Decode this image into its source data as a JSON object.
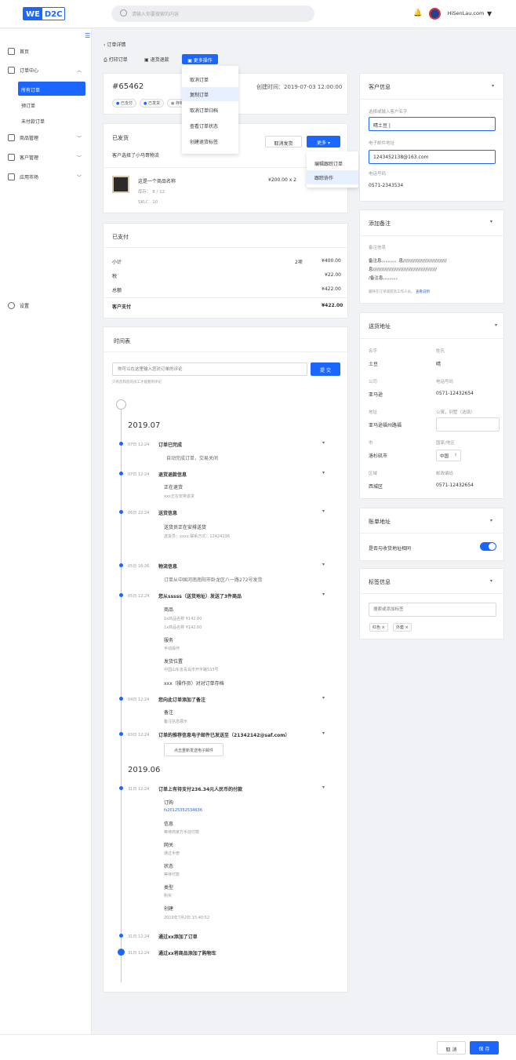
{
  "header": {
    "logo_we": "WE",
    "logo_d2c": "D2C",
    "search_placeholder": "请输入你要搜索的内容",
    "user": "HiSenLau.com"
  },
  "sidebar": {
    "home": "首页",
    "orders": "订单中心",
    "all_orders": "所有订单",
    "pre_orders": "预订单",
    "unpaid": "未付款订单",
    "products": "商品管理",
    "customers": "客户管理",
    "market": "应用市场",
    "settings": "设置"
  },
  "toolbar": {
    "back": "订单详情",
    "print": "打印订单",
    "refund": "退货退款",
    "more": "更多操作"
  },
  "more_menu": [
    "取消订单",
    "复制订单",
    "取消订单归档",
    "查看订单状态",
    "创建退货标签"
  ],
  "order": {
    "id": "#65462",
    "created": "创建时间：2019-07-03 12:00:00",
    "tags": [
      "已支付",
      "已发货",
      "存档"
    ]
  },
  "shipping": {
    "title": "已发货",
    "desc": "客户选择了小马哥物流",
    "cancel": "取消发货",
    "more": "更多",
    "menu": [
      "编辑跟踪订单",
      "跟踪协作"
    ],
    "item_name": "这是一个商品名称",
    "item_price": "¥200.00  x 2",
    "stock": "库存： 8 / 12",
    "sku": "SKU： 10"
  },
  "payment": {
    "title": "已支付",
    "rows": [
      {
        "k": "小计",
        "m": "2项",
        "v": "¥400.00"
      },
      {
        "k": "税",
        "m": "",
        "v": "¥22.00"
      },
      {
        "k": "总额",
        "m": "",
        "v": "¥422.00"
      }
    ],
    "paid_k": "客户支付",
    "paid_v": "¥422.00"
  },
  "timeline": {
    "title": "时间表",
    "placeholder": "你可以在这里输入您对订单的评论",
    "submit": "提 交",
    "note": "只有您和您的员工才能看到评论",
    "y1": "2019.07",
    "y2": "2019.06",
    "e1d": "07日 12:24",
    "e1t": "订单已完成",
    "e1s": "自动完成订单，交易关闭",
    "e2d": "07日 12:24",
    "e2t": "退货退款信息",
    "e2a": "正在退货",
    "e2b": "xxx正在安排退货",
    "e3d": "06日 22:24",
    "e3t": "送货信息",
    "e3a": "送货员正在安排送货",
    "e3b": "送货员：xxxx    联系方式：12424236",
    "e4d": "05日 16:26",
    "e4t": "物流信息",
    "e4s": "订单从中国河南南阳市卧龙区八一路272号发货",
    "e5d": "05日 12:24",
    "e5t": "您从sssss（送货地址）发送了3件商品",
    "e5a": "商品",
    "e5b": "1x商品名称   ¥142.00",
    "e5c": "1x商品名称   ¥142.00",
    "e5d2": "服务",
    "e5e": "手动操作",
    "e5f": "发货位置",
    "e5g": "中国山东省青岛市开平路533号",
    "e5h": "xxx（操作员）对对订单存档",
    "e6d": "04日 12:24",
    "e6t": "您向此订单添加了备注",
    "e6a": "备注",
    "e6b": "备注信息展示",
    "e7d": "03日 12:24",
    "e7t": "订单的推荐信息电子邮件已发送至（21342142@saf.com）",
    "e7btn": "点击重新发送电子邮件",
    "e8d": "31日 12:24",
    "e8t": "订单上有待支付236.34元人民币的付款",
    "e8a": "订购",
    "e8b": "fs20125352534636",
    "e8c": "信息",
    "e8d2": "等待商家方手动付款",
    "e8e": "网关",
    "e8f": "通过手册",
    "e8g": "状态",
    "e8h": "等待付款",
    "e8i": "类型",
    "e8j": "购买",
    "e8k": "创建",
    "e8l": "2019年7月2日  15:40:52",
    "e9d": "31日 12:24",
    "e9t": "通过xx添加了订单",
    "e10d": "31日 12:24",
    "e10t": "通过xx将商品添加了购物车"
  },
  "customer": {
    "title": "客户信息",
    "name_label": "选择或输入客户名字",
    "name_value": "晴土豆 |",
    "email_label": "电子邮件地址",
    "email_value": "1243452138@163.com",
    "phone_label": "电话号码",
    "phone_value": "0571-2343534"
  },
  "remark": {
    "title": "添加备注",
    "label": "备注信息",
    "l1": "备注息。。。。。。。息//////////////////////////////",
    "l2": "息////////////////////////////////////////////",
    "l3": "/备注息。。。。。。。",
    "tip": "最终在订单或提及工作人员。",
    "link": "查看说明"
  },
  "address": {
    "title": "送货地址",
    "name_l": "名字",
    "name_v": "土豆",
    "surname_l": "姓氏",
    "surname_v": "晴",
    "company_l": "公司",
    "company_v": "亚马逊",
    "tel_l": "电话号码",
    "tel_v": "0571-12432654",
    "addr_l": "地址",
    "addr_v": "亚马逊福州路福",
    "apt_l": "公寓，别墅（选填）",
    "city_l": "市",
    "city_v": "洛杉矶市",
    "country_l": "国家/地区",
    "country_v": "中国",
    "region_l": "区域",
    "region_v": "西城区",
    "zip_l": "邮政编码",
    "zip_v": "0571-12432654"
  },
  "billing": {
    "title": "账单地址",
    "same": "是否与收货地址相同"
  },
  "tags_card": {
    "title": "标签信息",
    "placeholder": "搜索或添加标签",
    "tags": [
      "红色",
      "外套"
    ]
  },
  "footer": {
    "cancel": "取 消",
    "save": "保 存"
  },
  "colors": {
    "accent": "#1a66ff"
  }
}
